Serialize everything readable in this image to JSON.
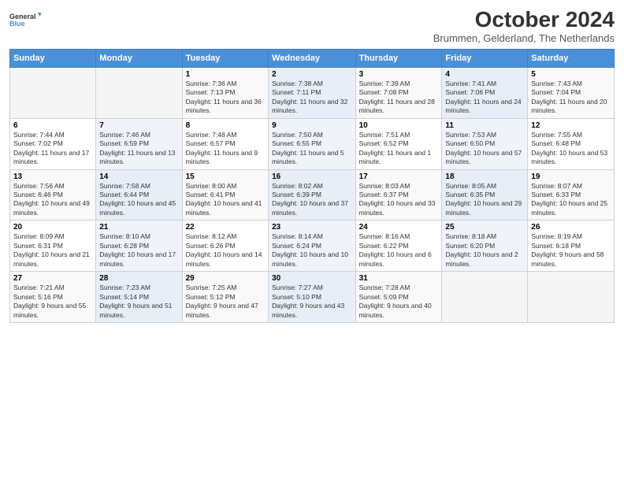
{
  "header": {
    "logo_line1": "General",
    "logo_line2": "Blue",
    "month_title": "October 2024",
    "subtitle": "Brummen, Gelderland, The Netherlands"
  },
  "weekdays": [
    "Sunday",
    "Monday",
    "Tuesday",
    "Wednesday",
    "Thursday",
    "Friday",
    "Saturday"
  ],
  "weeks": [
    [
      {
        "num": "",
        "sunrise": "",
        "sunset": "",
        "daylight": ""
      },
      {
        "num": "",
        "sunrise": "",
        "sunset": "",
        "daylight": ""
      },
      {
        "num": "1",
        "sunrise": "Sunrise: 7:36 AM",
        "sunset": "Sunset: 7:13 PM",
        "daylight": "Daylight: 11 hours and 36 minutes."
      },
      {
        "num": "2",
        "sunrise": "Sunrise: 7:38 AM",
        "sunset": "Sunset: 7:11 PM",
        "daylight": "Daylight: 11 hours and 32 minutes."
      },
      {
        "num": "3",
        "sunrise": "Sunrise: 7:39 AM",
        "sunset": "Sunset: 7:08 PM",
        "daylight": "Daylight: 11 hours and 28 minutes."
      },
      {
        "num": "4",
        "sunrise": "Sunrise: 7:41 AM",
        "sunset": "Sunset: 7:06 PM",
        "daylight": "Daylight: 11 hours and 24 minutes."
      },
      {
        "num": "5",
        "sunrise": "Sunrise: 7:43 AM",
        "sunset": "Sunset: 7:04 PM",
        "daylight": "Daylight: 11 hours and 20 minutes."
      }
    ],
    [
      {
        "num": "6",
        "sunrise": "Sunrise: 7:44 AM",
        "sunset": "Sunset: 7:02 PM",
        "daylight": "Daylight: 11 hours and 17 minutes."
      },
      {
        "num": "7",
        "sunrise": "Sunrise: 7:46 AM",
        "sunset": "Sunset: 6:59 PM",
        "daylight": "Daylight: 11 hours and 13 minutes."
      },
      {
        "num": "8",
        "sunrise": "Sunrise: 7:48 AM",
        "sunset": "Sunset: 6:57 PM",
        "daylight": "Daylight: 11 hours and 9 minutes."
      },
      {
        "num": "9",
        "sunrise": "Sunrise: 7:50 AM",
        "sunset": "Sunset: 6:55 PM",
        "daylight": "Daylight: 11 hours and 5 minutes."
      },
      {
        "num": "10",
        "sunrise": "Sunrise: 7:51 AM",
        "sunset": "Sunset: 6:52 PM",
        "daylight": "Daylight: 11 hours and 1 minute."
      },
      {
        "num": "11",
        "sunrise": "Sunrise: 7:53 AM",
        "sunset": "Sunset: 6:50 PM",
        "daylight": "Daylight: 10 hours and 57 minutes."
      },
      {
        "num": "12",
        "sunrise": "Sunrise: 7:55 AM",
        "sunset": "Sunset: 6:48 PM",
        "daylight": "Daylight: 10 hours and 53 minutes."
      }
    ],
    [
      {
        "num": "13",
        "sunrise": "Sunrise: 7:56 AM",
        "sunset": "Sunset: 6:46 PM",
        "daylight": "Daylight: 10 hours and 49 minutes."
      },
      {
        "num": "14",
        "sunrise": "Sunrise: 7:58 AM",
        "sunset": "Sunset: 6:44 PM",
        "daylight": "Daylight: 10 hours and 45 minutes."
      },
      {
        "num": "15",
        "sunrise": "Sunrise: 8:00 AM",
        "sunset": "Sunset: 6:41 PM",
        "daylight": "Daylight: 10 hours and 41 minutes."
      },
      {
        "num": "16",
        "sunrise": "Sunrise: 8:02 AM",
        "sunset": "Sunset: 6:39 PM",
        "daylight": "Daylight: 10 hours and 37 minutes."
      },
      {
        "num": "17",
        "sunrise": "Sunrise: 8:03 AM",
        "sunset": "Sunset: 6:37 PM",
        "daylight": "Daylight: 10 hours and 33 minutes."
      },
      {
        "num": "18",
        "sunrise": "Sunrise: 8:05 AM",
        "sunset": "Sunset: 6:35 PM",
        "daylight": "Daylight: 10 hours and 29 minutes."
      },
      {
        "num": "19",
        "sunrise": "Sunrise: 8:07 AM",
        "sunset": "Sunset: 6:33 PM",
        "daylight": "Daylight: 10 hours and 25 minutes."
      }
    ],
    [
      {
        "num": "20",
        "sunrise": "Sunrise: 8:09 AM",
        "sunset": "Sunset: 6:31 PM",
        "daylight": "Daylight: 10 hours and 21 minutes."
      },
      {
        "num": "21",
        "sunrise": "Sunrise: 8:10 AM",
        "sunset": "Sunset: 6:28 PM",
        "daylight": "Daylight: 10 hours and 17 minutes."
      },
      {
        "num": "22",
        "sunrise": "Sunrise: 8:12 AM",
        "sunset": "Sunset: 6:26 PM",
        "daylight": "Daylight: 10 hours and 14 minutes."
      },
      {
        "num": "23",
        "sunrise": "Sunrise: 8:14 AM",
        "sunset": "Sunset: 6:24 PM",
        "daylight": "Daylight: 10 hours and 10 minutes."
      },
      {
        "num": "24",
        "sunrise": "Sunrise: 8:16 AM",
        "sunset": "Sunset: 6:22 PM",
        "daylight": "Daylight: 10 hours and 6 minutes."
      },
      {
        "num": "25",
        "sunrise": "Sunrise: 8:18 AM",
        "sunset": "Sunset: 6:20 PM",
        "daylight": "Daylight: 10 hours and 2 minutes."
      },
      {
        "num": "26",
        "sunrise": "Sunrise: 8:19 AM",
        "sunset": "Sunset: 6:18 PM",
        "daylight": "Daylight: 9 hours and 58 minutes."
      }
    ],
    [
      {
        "num": "27",
        "sunrise": "Sunrise: 7:21 AM",
        "sunset": "Sunset: 5:16 PM",
        "daylight": "Daylight: 9 hours and 55 minutes."
      },
      {
        "num": "28",
        "sunrise": "Sunrise: 7:23 AM",
        "sunset": "Sunset: 5:14 PM",
        "daylight": "Daylight: 9 hours and 51 minutes."
      },
      {
        "num": "29",
        "sunrise": "Sunrise: 7:25 AM",
        "sunset": "Sunset: 5:12 PM",
        "daylight": "Daylight: 9 hours and 47 minutes."
      },
      {
        "num": "30",
        "sunrise": "Sunrise: 7:27 AM",
        "sunset": "Sunset: 5:10 PM",
        "daylight": "Daylight: 9 hours and 43 minutes."
      },
      {
        "num": "31",
        "sunrise": "Sunrise: 7:28 AM",
        "sunset": "Sunset: 5:09 PM",
        "daylight": "Daylight: 9 hours and 40 minutes."
      },
      {
        "num": "",
        "sunrise": "",
        "sunset": "",
        "daylight": ""
      },
      {
        "num": "",
        "sunrise": "",
        "sunset": "",
        "daylight": ""
      }
    ]
  ]
}
